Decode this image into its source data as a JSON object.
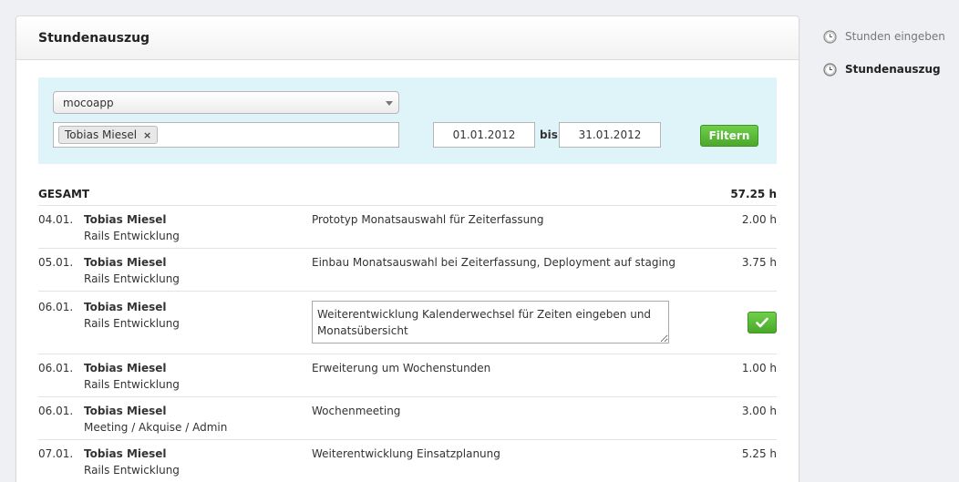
{
  "panel": {
    "title": "Stundenauszug"
  },
  "filter": {
    "project_select": "mocoapp",
    "user_token": "Tobias Miesel",
    "token_remove": "×",
    "date_from": "01.01.2012",
    "bis_label": "bis",
    "date_to": "31.01.2012",
    "filter_button": "Filtern"
  },
  "summary": {
    "label": "GESAMT",
    "total": "57.25 h"
  },
  "rows": [
    {
      "date": "04.01.",
      "name": "Tobias Miesel",
      "project": "Rails Entwicklung",
      "description": "Prototyp Monatsauswahl für Zeiterfassung",
      "hours": "2.00 h"
    },
    {
      "date": "05.01.",
      "name": "Tobias Miesel",
      "project": "Rails Entwicklung",
      "description": "Einbau Monatsauswahl bei Zeiterfassung, Deployment auf staging",
      "hours": "3.75 h"
    },
    {
      "date": "06.01.",
      "name": "Tobias Miesel",
      "project": "Rails Entwicklung",
      "description": "Weiterentwicklung Kalenderwechsel für Zeiten eingeben und Monatsübersicht",
      "hours": ""
    },
    {
      "date": "06.01.",
      "name": "Tobias Miesel",
      "project": "Rails Entwicklung",
      "description": "Erweiterung um Wochenstunden",
      "hours": "1.00 h"
    },
    {
      "date": "06.01.",
      "name": "Tobias Miesel",
      "project": "Meeting / Akquise / Admin",
      "description": "Wochenmeeting",
      "hours": "3.00 h"
    },
    {
      "date": "07.01.",
      "name": "Tobias Miesel",
      "project": "Rails Entwicklung",
      "description": "Weiterentwicklung Einsatzplanung",
      "hours": "5.25 h"
    }
  ],
  "sidebar": {
    "items": [
      {
        "label": "Stunden eingeben",
        "icon": "clock-icon",
        "active": false
      },
      {
        "label": "Stundenauszug",
        "icon": "clock-icon",
        "active": true
      }
    ]
  },
  "colors": {
    "accent_green": "#4ba82a",
    "filter_bg": "#def4f9"
  }
}
